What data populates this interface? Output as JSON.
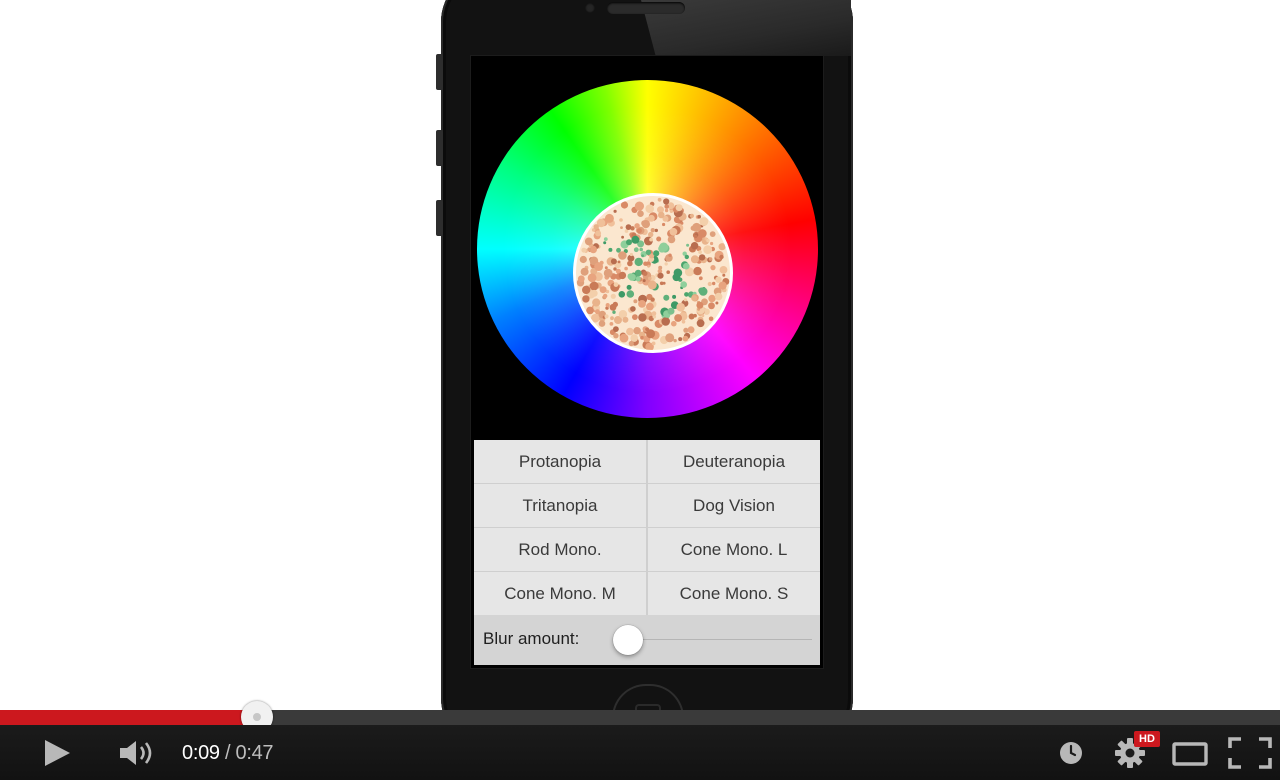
{
  "app": {
    "buttons": [
      [
        "Protanopia",
        "Deuteranopia"
      ],
      [
        "Tritanopia",
        "Dog Vision"
      ],
      [
        "Rod Mono.",
        "Cone Mono. L"
      ],
      [
        "Cone Mono. M",
        "Cone Mono. S"
      ]
    ],
    "blur_label": "Blur amount:",
    "blur_value": 0.0
  },
  "player": {
    "current_time": "0:09",
    "separator": " / ",
    "duration": "0:47",
    "played_fraction": 0.201,
    "loaded_fraction": 0.0,
    "hd_label": "HD",
    "icons": [
      "play-icon",
      "volume-icon",
      "watch-later-icon",
      "settings-icon",
      "theater-mode-icon",
      "fullscreen-icon"
    ],
    "accent_color": "#cc181e"
  }
}
